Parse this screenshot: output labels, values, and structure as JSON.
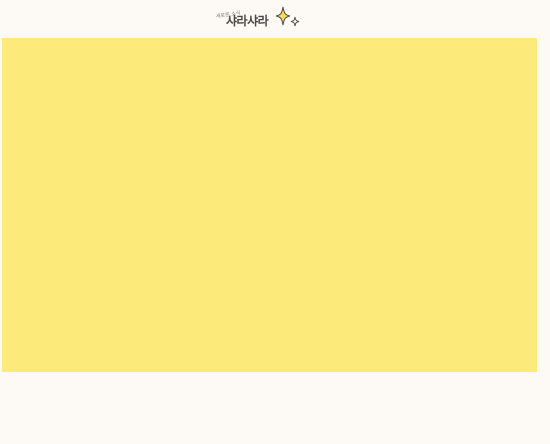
{
  "brand": {
    "tagline": "새로운 소식",
    "name": "샤라샤라"
  },
  "colors": {
    "page_background": "#fdfaf5",
    "hero_background": "#fcea7b",
    "sparkle": "#f4de54",
    "logo_text": "#4a4745"
  }
}
